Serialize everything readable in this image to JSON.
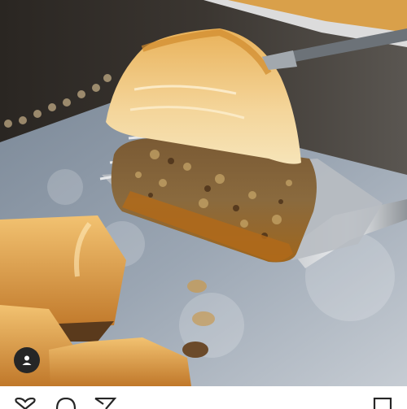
{
  "post": {
    "media_icon": "fork-with-baklava-photo",
    "tag_icon": "person-tag-icon"
  },
  "actions": {
    "like_icon": "heart-icon",
    "comment_icon": "comment-icon",
    "share_icon": "paper-plane-icon",
    "save_icon": "bookmark-icon"
  },
  "colors": {
    "icon": "#262626",
    "background": "#ffffff"
  }
}
